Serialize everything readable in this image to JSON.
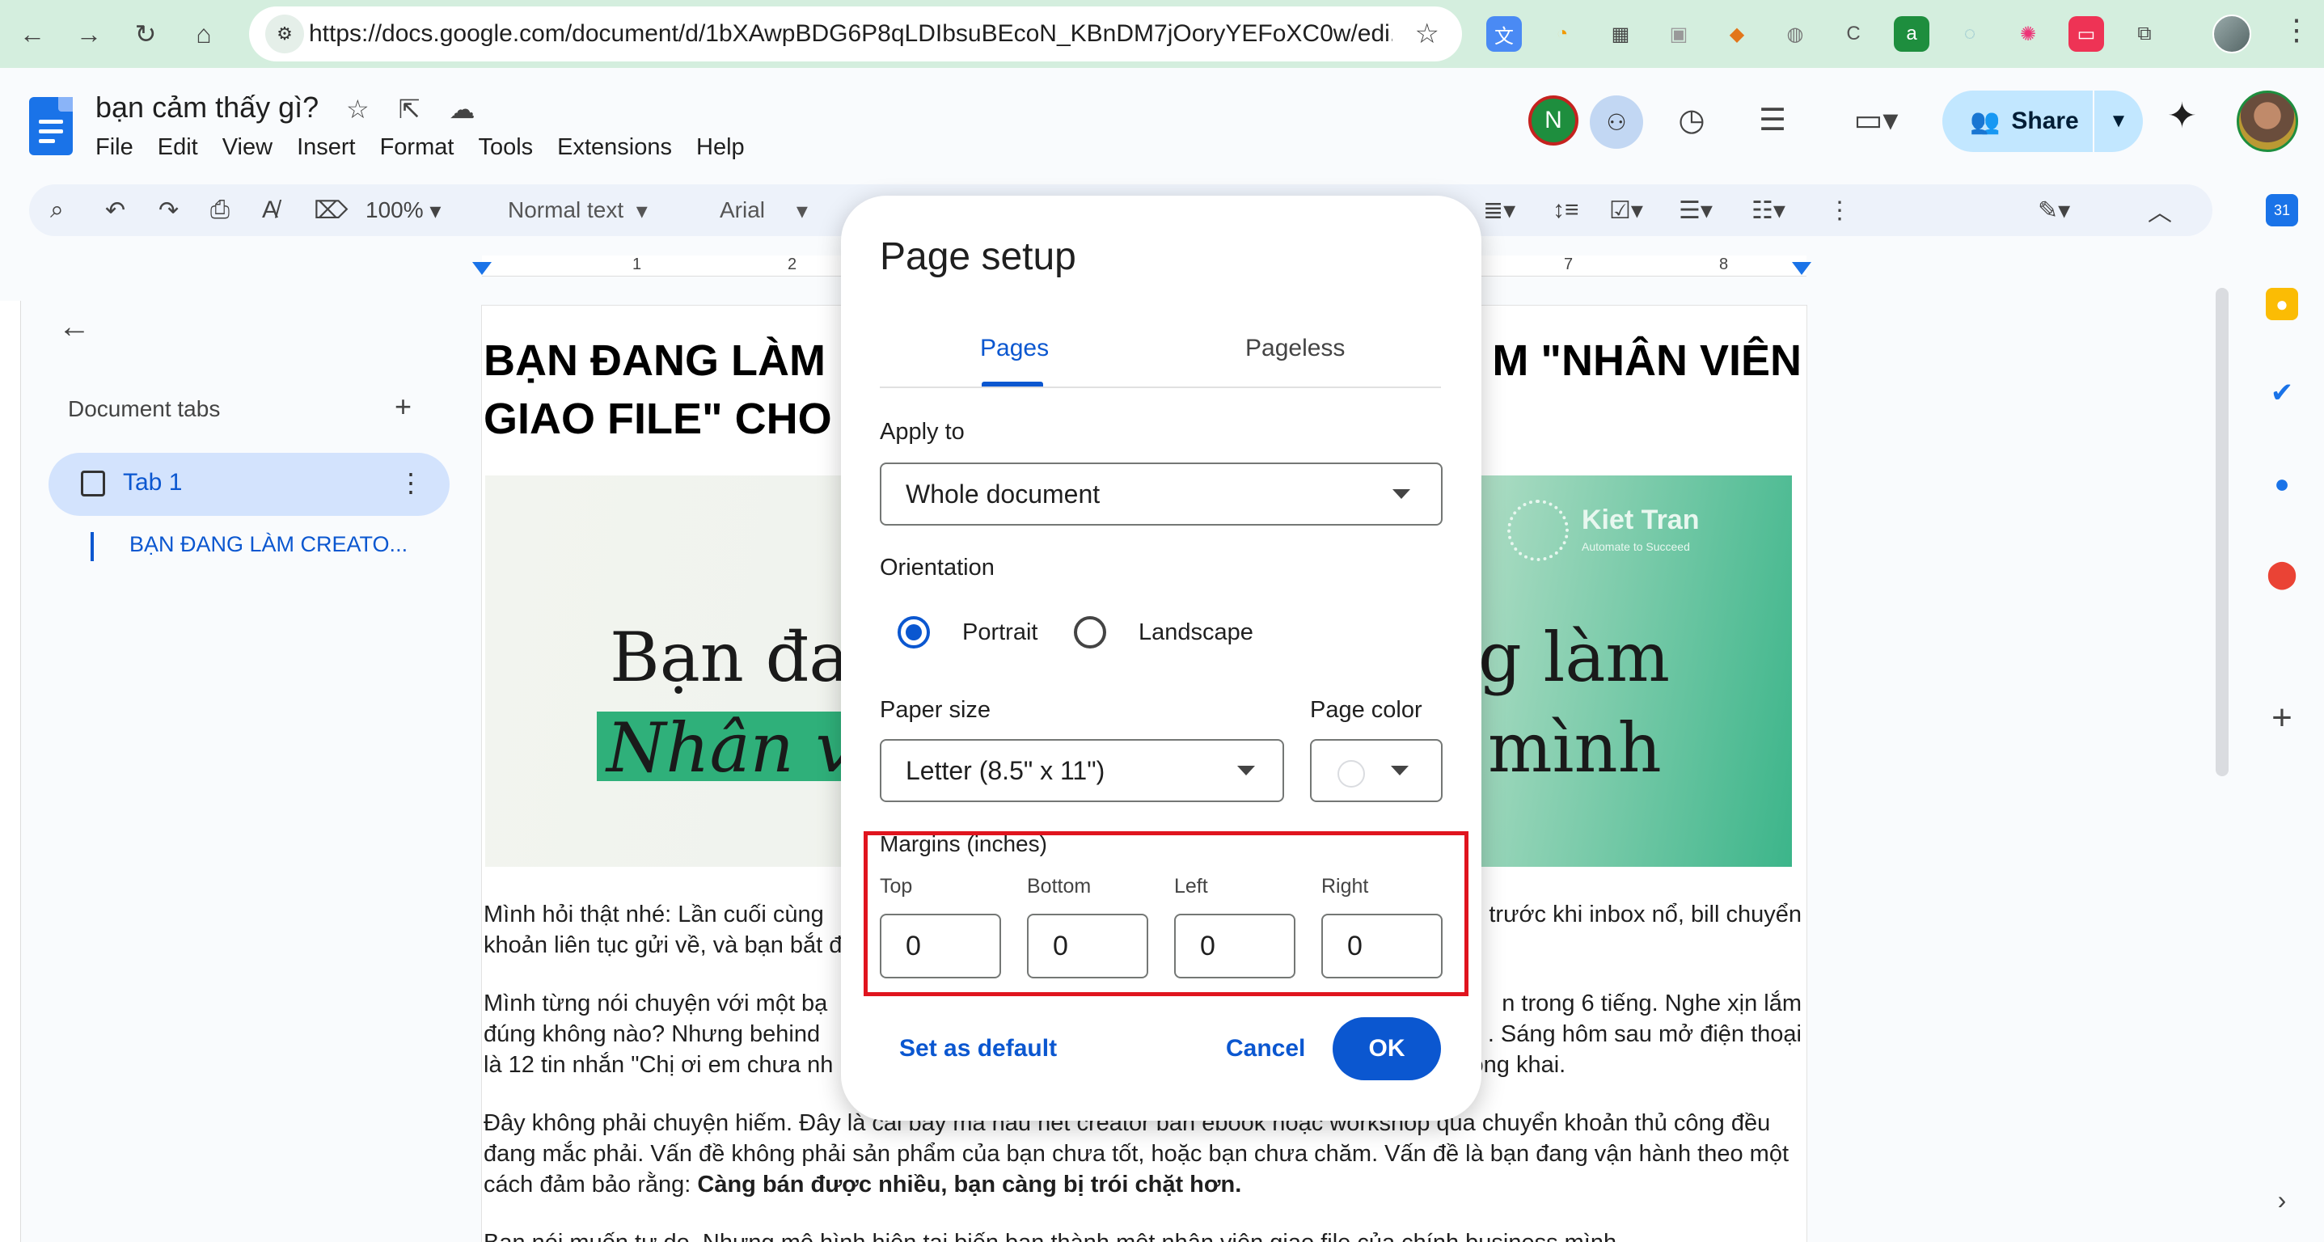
{
  "browser": {
    "url": "https://docs.google.com/document/d/1bXAwpBDG6P8qLDIbsuBEcoN_KBnDM7jOoryYEFoXC0w/edi...",
    "back_icon": "arrow-left-icon",
    "forward_icon": "arrow-right-icon",
    "reload_icon": "reload-icon",
    "home_icon": "home-icon"
  },
  "docs": {
    "title": "bạn cảm thấy gì?",
    "menu": [
      "File",
      "Edit",
      "View",
      "Insert",
      "Format",
      "Tools",
      "Extensions",
      "Help"
    ],
    "avatar_letter": "N",
    "share_label": "Share",
    "zoom": "100%",
    "style": "Normal text",
    "font": "Arial"
  },
  "ruler": [
    "1",
    "2",
    "7",
    "8"
  ],
  "sidebar": {
    "title": "Document tabs",
    "tab_label": "Tab 1",
    "outline_item": "BẠN ĐANG LÀM CREATO..."
  },
  "document": {
    "heading_line1_left": "BẠN ĐANG LÀM",
    "heading_line1_right": "M \"NHÂN VIÊN",
    "heading_line2": "GIAO FILE\" CHO",
    "banner_text_1": "Bạn đang",
    "banner_text_2": "Nhân viê",
    "banner_text_3": "g làm",
    "banner_text_4": "mình",
    "banner_brand": "Kiet Tran",
    "banner_brand_sub": "Automate to Succeed",
    "p1_l1_left": "Mình hỏi thật nhé: Lần cuối cùng",
    "p1_l1_right": "trước khi inbox nổ, bill chuyển",
    "p1_l2_left": "khoản liên tục gửi về, và bạn bắt đ",
    "p2_l1_left": "Mình từng nói chuyện với một bạ",
    "p2_l1_right": "n trong 6 tiếng. Nghe xịn lắm",
    "p2_l2_left": "đúng không nào? Nhưng behind",
    "p2_l2_right": ". Sáng hôm sau mở điện thoại",
    "p2_l3_left": "là 12 tin nhắn \"Chị ơi em chưa nh",
    "p2_l3_right": "công khai.",
    "p3_l1": "Đây không phải chuyện hiếm. Đây là cái bẫy mà hầu hết creator bán ebook hoặc workshop qua chuyển khoản thủ công đều",
    "p3_l2": "đang mắc phải. Vấn đề không phải sản phẩm của bạn chưa tốt, hoặc bạn chưa chăm. Vấn đề là bạn đang vận hành theo một",
    "p3_l3_normal": "cách đảm bảo rằng: ",
    "p3_l3_bold": "Càng bán được nhiều, bạn càng bị trói chặt hơn.",
    "p4_l1": "Bạn nói muốn tự do. Nhưng mô hình hiện tại biến bạn thành một nhân viên giao file của chính business mình."
  },
  "dialog": {
    "title": "Page setup",
    "tab_pages": "Pages",
    "tab_pageless": "Pageless",
    "apply_to_label": "Apply to",
    "apply_to_value": "Whole document",
    "orientation_label": "Orientation",
    "portrait": "Portrait",
    "landscape": "Landscape",
    "orientation_selected": "Portrait",
    "paper_size_label": "Paper size",
    "paper_size_value": "Letter (8.5\" x 11\")",
    "page_color_label": "Page color",
    "page_color_value": "#ffffff",
    "margins_label": "Margins (inches)",
    "margin_top_label": "Top",
    "margin_bottom_label": "Bottom",
    "margin_left_label": "Left",
    "margin_right_label": "Right",
    "margin_top": "0",
    "margin_bottom": "0",
    "margin_left": "0",
    "margin_right": "0",
    "set_default": "Set as default",
    "cancel": "Cancel",
    "ok": "OK"
  },
  "colors": {
    "accent": "#0b57d0",
    "highlight_box": "#e0141e",
    "chrome": "#d4eede",
    "share_bg": "#c2e7ff"
  }
}
